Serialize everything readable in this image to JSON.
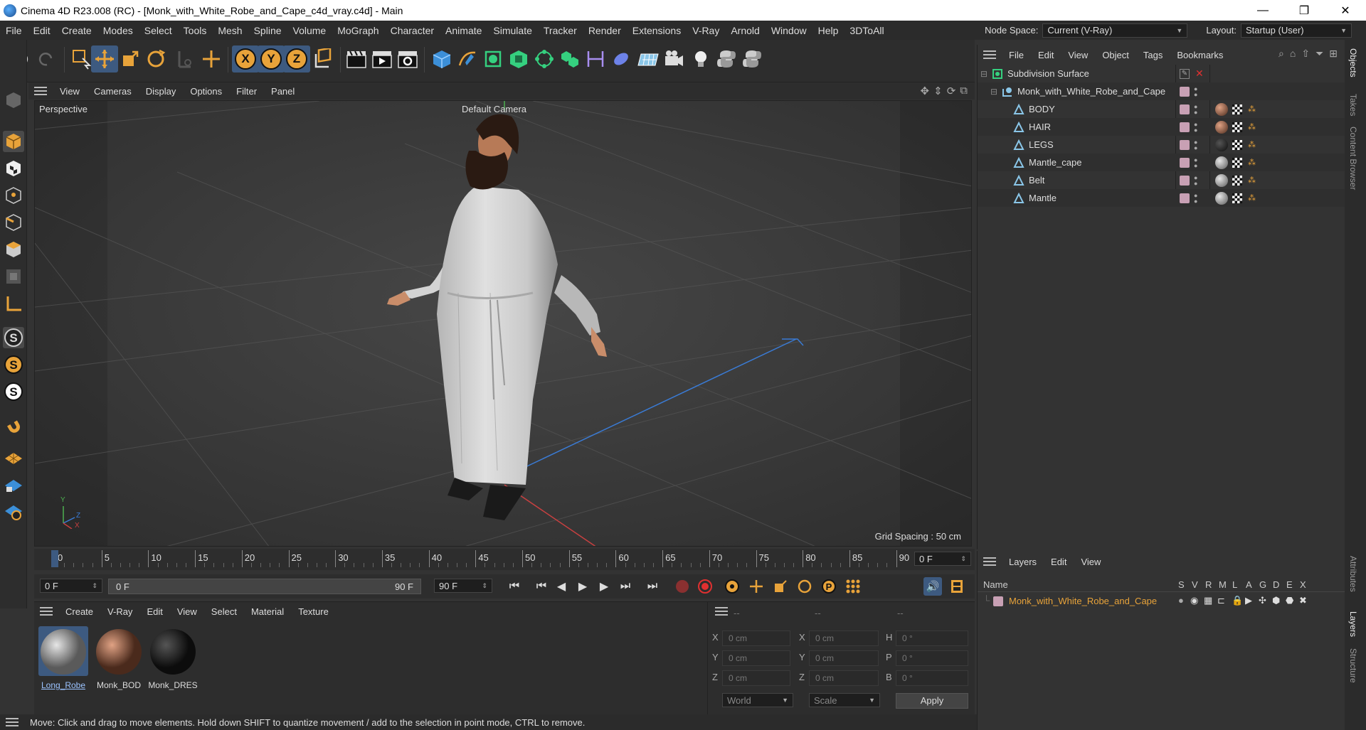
{
  "window": {
    "title": "Cinema 4D R23.008 (RC) - [Monk_with_White_Robe_and_Cape_c4d_vray.c4d] - Main",
    "minimize": "—",
    "restore": "❐",
    "close": "✕"
  },
  "menu": [
    "File",
    "Edit",
    "Create",
    "Modes",
    "Select",
    "Tools",
    "Mesh",
    "Spline",
    "Volume",
    "MoGraph",
    "Character",
    "Animate",
    "Simulate",
    "Tracker",
    "Render",
    "Extensions",
    "V-Ray",
    "Arnold",
    "Window",
    "Help",
    "3DToAll"
  ],
  "nodespace": {
    "label": "Node Space:",
    "value": "Current (V-Ray)"
  },
  "layout": {
    "label": "Layout:",
    "value": "Startup (User)"
  },
  "viewport_menu": [
    "View",
    "Cameras",
    "Display",
    "Options",
    "Filter",
    "Panel"
  ],
  "viewport": {
    "label": "Perspective",
    "camera": "Default Camera",
    "grid_spacing": "Grid Spacing : 50 cm",
    "axis_y": "Y",
    "axis_z": "Z",
    "axis_x": "X"
  },
  "timeline": {
    "ticks": [
      "0",
      "5",
      "10",
      "15",
      "20",
      "25",
      "30",
      "35",
      "40",
      "45",
      "50",
      "55",
      "60",
      "65",
      "70",
      "75",
      "80",
      "85",
      "90"
    ],
    "current_frame": "0 F"
  },
  "playbar": {
    "start": "0 F",
    "range_start": "0 F",
    "range_end": "90 F",
    "end": "90 F"
  },
  "objects_menu": [
    "File",
    "Edit",
    "View",
    "Object",
    "Tags",
    "Bookmarks"
  ],
  "objects": [
    {
      "name": "Subdivision Surface",
      "level": 0
    },
    {
      "name": "Monk_with_White_Robe_and_Cape",
      "level": 1
    },
    {
      "name": "BODY",
      "level": 2
    },
    {
      "name": "HAIR",
      "level": 2
    },
    {
      "name": "LEGS",
      "level": 2
    },
    {
      "name": "Mantle_cape",
      "level": 2
    },
    {
      "name": "Belt",
      "level": 2
    },
    {
      "name": "Mantle",
      "level": 2
    }
  ],
  "layers_menu": [
    "Layers",
    "Edit",
    "View"
  ],
  "layers_header": {
    "name": "Name",
    "cols": [
      "S",
      "V",
      "R",
      "M",
      "L",
      "A",
      "G",
      "D",
      "E",
      "X"
    ]
  },
  "layer_row": {
    "name": "Monk_with_White_Robe_and_Cape"
  },
  "material_menu": [
    "Create",
    "V-Ray",
    "Edit",
    "View",
    "Select",
    "Material",
    "Texture"
  ],
  "materials": [
    "Long_Robe",
    "Monk_BOD",
    "Monk_DRES"
  ],
  "coords": {
    "header": [
      "--",
      "--",
      "--"
    ],
    "rows": [
      {
        "l1": "X",
        "v1": "0 cm",
        "l2": "X",
        "v2": "0 cm",
        "l3": "H",
        "v3": "0 °"
      },
      {
        "l1": "Y",
        "v1": "0 cm",
        "l2": "Y",
        "v2": "0 cm",
        "l3": "P",
        "v3": "0 °"
      },
      {
        "l1": "Z",
        "v1": "0 cm",
        "l2": "Z",
        "v2": "0 cm",
        "l3": "B",
        "v3": "0 °"
      }
    ],
    "space": "World",
    "mode": "Scale",
    "apply": "Apply"
  },
  "right_tabs": [
    "Objects",
    "Takes",
    "Content Browser",
    "Attributes",
    "Layers",
    "Structure"
  ],
  "status": "Move: Click and drag to move elements. Hold down SHIFT to quantize movement / add to the selection in point mode, CTRL to remove.",
  "colors": {
    "accent": "#e8a33a",
    "selected": "#3d5a80",
    "layer_color": "#c8a0b4"
  }
}
